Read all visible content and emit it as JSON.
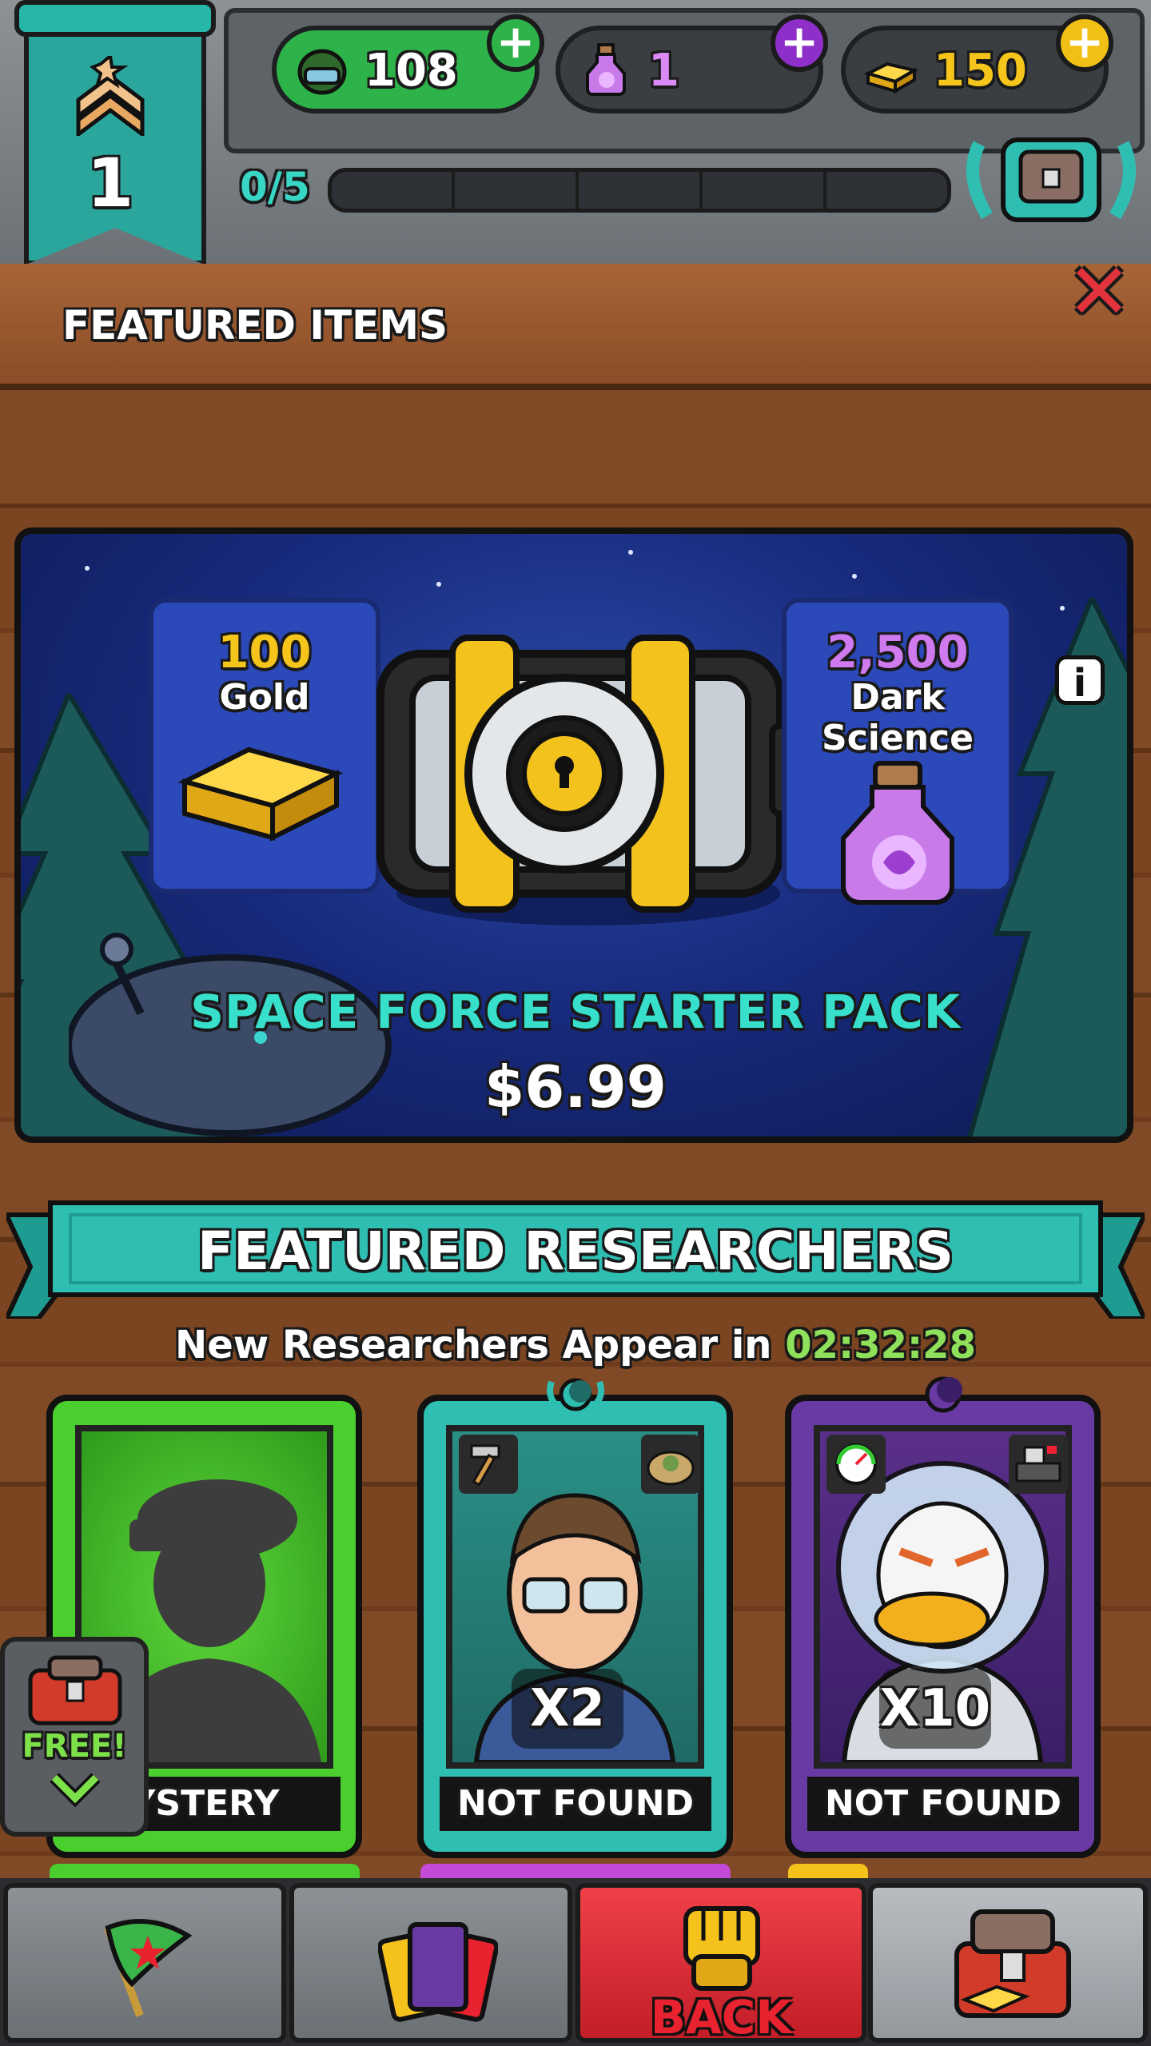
{
  "top_bar": {
    "rank": "1",
    "currencies": [
      {
        "name": "soldiers",
        "value": "108",
        "color": "#2eb34a",
        "plus_color": "#2eb34a"
      },
      {
        "name": "dark_science",
        "value": "1",
        "color": "#b56be0",
        "plus_color": "#8d2fc8"
      },
      {
        "name": "gold",
        "value": "150",
        "color": "#f5c21b",
        "plus_color": "#f2c014"
      }
    ],
    "xp_progress": "0/5",
    "xp_fraction": 0
  },
  "featured_items": {
    "title": "FEATURED ITEMS",
    "pack": {
      "rewards": [
        {
          "amount": "100",
          "name": "Gold",
          "amount_color": "#f6c51c"
        },
        {
          "amount": "2,500",
          "name": "Dark Science",
          "amount_color": "#d07af0"
        }
      ],
      "name": "SPACE FORCE STARTER PACK",
      "price": "$6.99"
    }
  },
  "featured_researchers": {
    "title": "FEATURED RESEARCHERS",
    "timer_prefix": "New Researchers Appear in",
    "timer": "02:32:28",
    "cards": [
      {
        "label": "MYSTERY",
        "label_visible": "YSTERY",
        "multiplier": "",
        "color": "#4bcf2e"
      },
      {
        "label": "NOT FOUND",
        "multiplier": "X2",
        "color": "#2fbfb2"
      },
      {
        "label": "NOT FOUND",
        "multiplier": "X10",
        "color": "#6a3aa4"
      }
    ],
    "free_label": "FREE!"
  },
  "bottom_nav": {
    "back_label": "BACK"
  }
}
